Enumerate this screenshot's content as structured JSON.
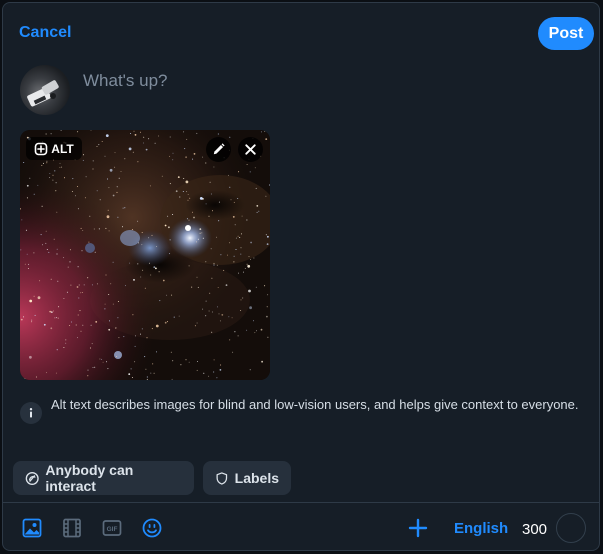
{
  "header": {
    "cancel_label": "Cancel",
    "post_label": "Post"
  },
  "composer": {
    "placeholder": "What's up?",
    "alt_label": "ALT"
  },
  "info": {
    "text": "Alt text describes images for blind and low-vision users, and helps give context to everyone."
  },
  "controls": {
    "interaction_label": "Anybody can interact",
    "labels_label": "Labels"
  },
  "toolbar": {
    "language_label": "English",
    "char_count": "300",
    "gif_label": "GIF",
    "icons": [
      "image-icon",
      "video-icon",
      "gif-icon",
      "emoji-icon",
      "plus-icon"
    ]
  },
  "colors": {
    "accent": "#208bfe",
    "background": "#161e27",
    "pill": "#26303c"
  }
}
